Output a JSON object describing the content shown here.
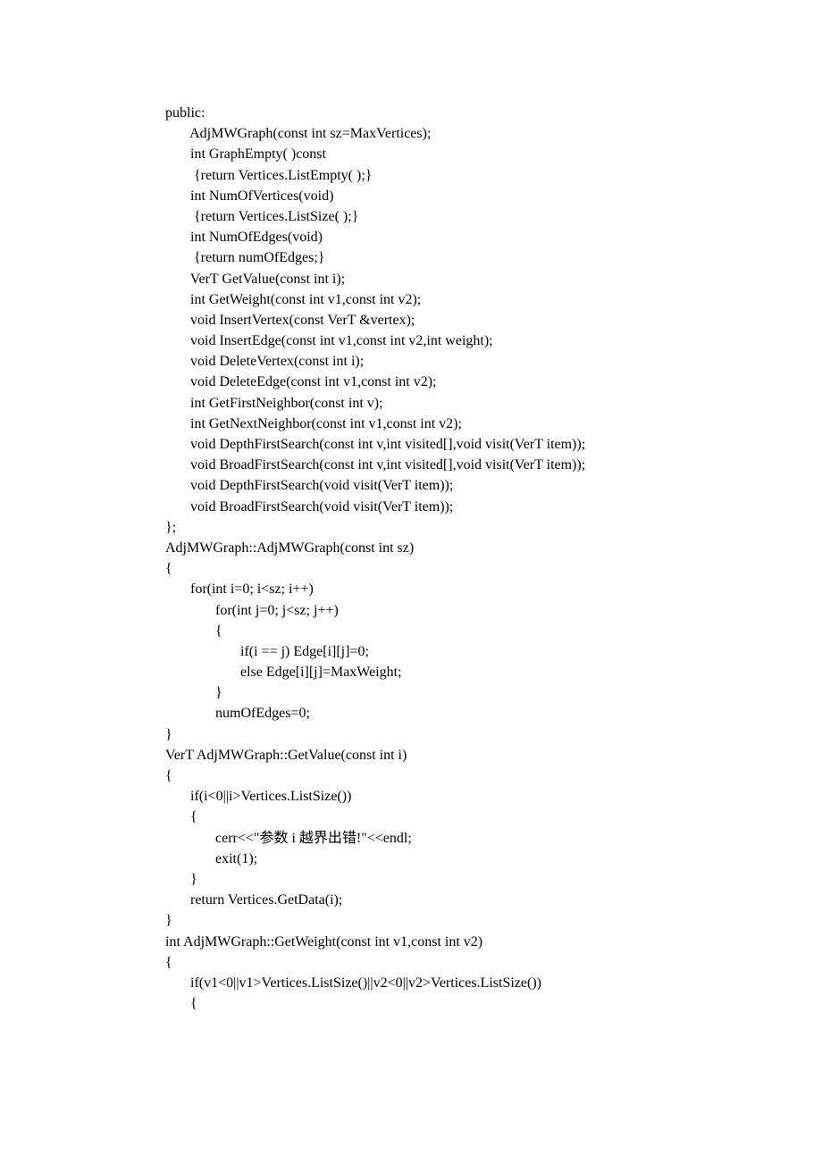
{
  "code_lines": [
    "public:",
    "       AdjMWGraph(const int sz=MaxVertices);",
    "       int GraphEmpty( )const",
    "        {return Vertices.ListEmpty( );}",
    "       int NumOfVertices(void)",
    "        {return Vertices.ListSize( );}",
    "       int NumOfEdges(void)",
    "        {return numOfEdges;}",
    "       VerT GetValue(const int i);",
    "       int GetWeight(const int v1,const int v2);",
    "       void InsertVertex(const VerT &vertex);",
    "       void InsertEdge(const int v1,const int v2,int weight);",
    "       void DeleteVertex(const int i);",
    "       void DeleteEdge(const int v1,const int v2);",
    "       int GetFirstNeighbor(const int v);",
    "       int GetNextNeighbor(const int v1,const int v2);",
    "       void DepthFirstSearch(const int v,int visited[],void visit(VerT item));",
    "       void BroadFirstSearch(const int v,int visited[],void visit(VerT item));",
    "       void DepthFirstSearch(void visit(VerT item));",
    "       void BroadFirstSearch(void visit(VerT item));",
    "};",
    "AdjMWGraph::AdjMWGraph(const int sz)",
    "{",
    "       for(int i=0; i<sz; i++)",
    "              for(int j=0; j<sz; j++)",
    "              {",
    "                     if(i == j) Edge[i][j]=0;",
    "                     else Edge[i][j]=MaxWeight;",
    "              }",
    "              numOfEdges=0;",
    "}",
    "VerT AdjMWGraph::GetValue(const int i)",
    "{",
    "       if(i<0||i>Vertices.ListSize())",
    "       {",
    "              cerr<<\"参数 i 越界出错!\"<<endl;",
    "              exit(1);",
    "       }",
    "       return Vertices.GetData(i);",
    "}",
    "int AdjMWGraph::GetWeight(const int v1,const int v2)",
    "{",
    "       if(v1<0||v1>Vertices.ListSize()||v2<0||v2>Vertices.ListSize())",
    "       {"
  ]
}
